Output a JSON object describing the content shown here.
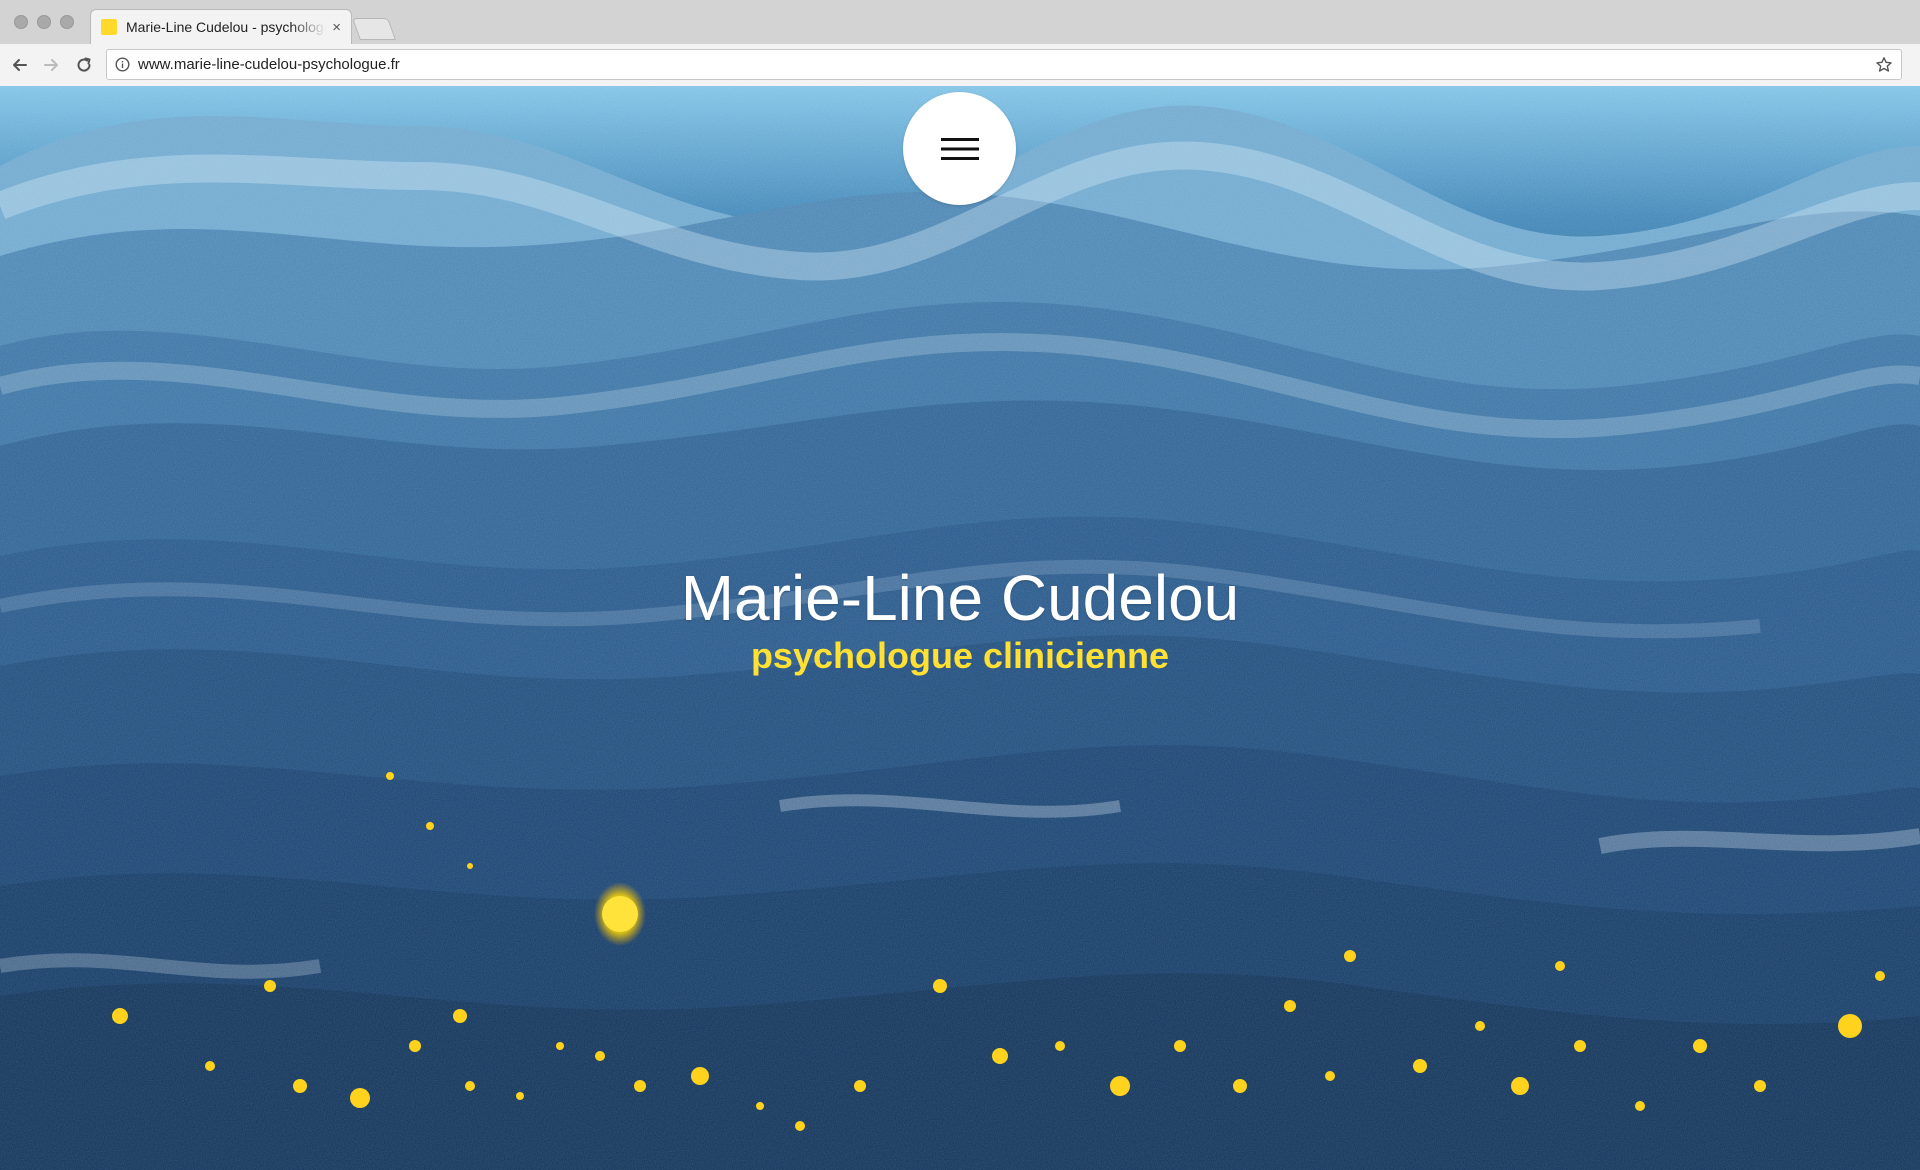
{
  "browser": {
    "tab": {
      "title": "Marie-Line Cudelou - psychologue clinicienne",
      "close_glyph": "×",
      "favicon_color": "#ffd92c"
    },
    "address_bar": {
      "url": "www.marie-line-cudelou-psychologue.fr"
    },
    "icons": {
      "back": "arrow-left-icon",
      "forward": "arrow-right-icon",
      "reload": "reload-icon",
      "info": "info-icon",
      "bookmark": "star-icon"
    }
  },
  "page": {
    "menu": {
      "icon": "hamburger-menu-icon"
    },
    "hero": {
      "title": "Marie-Line Cudelou",
      "subtitle": "psychologue clinicienne"
    },
    "colors": {
      "accent_yellow": "#ffe033",
      "title_white": "#ffffff",
      "sea_blue_dark": "#0a2f55",
      "sea_blue_light": "#7fc3e6"
    }
  }
}
